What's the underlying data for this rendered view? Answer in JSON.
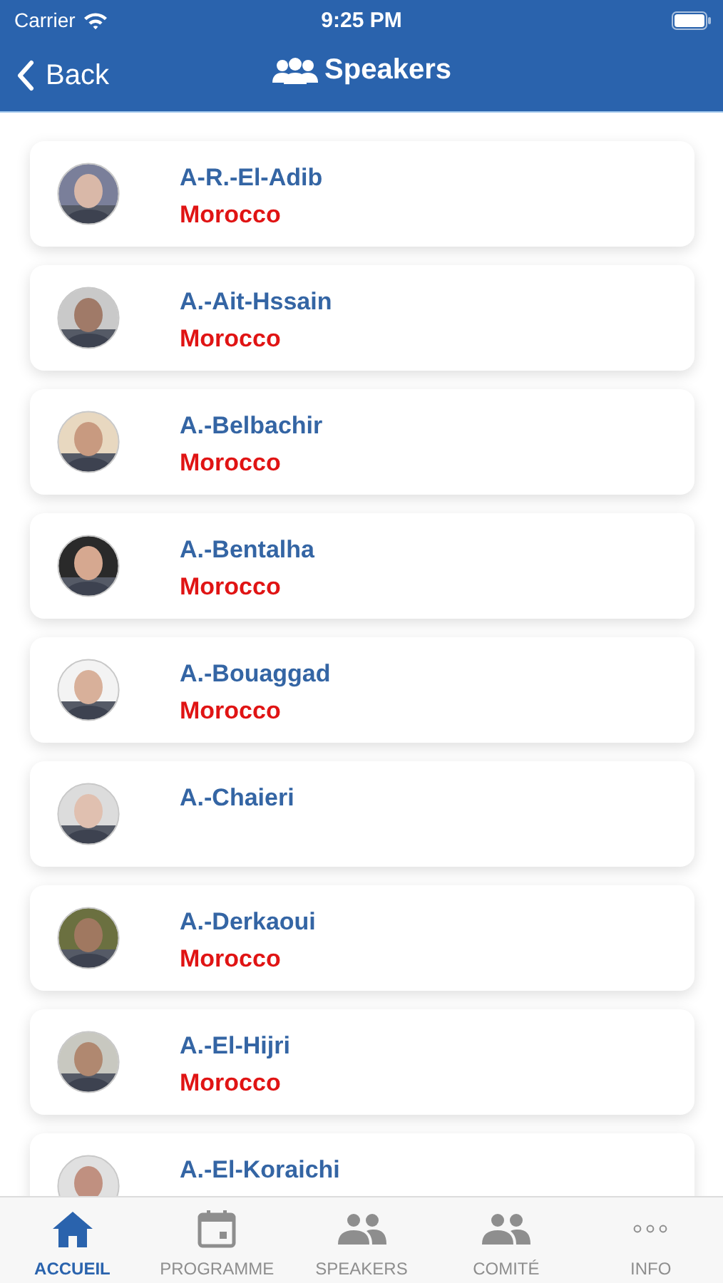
{
  "status_bar": {
    "carrier": "Carrier",
    "time": "9:25 PM"
  },
  "nav_bar": {
    "back": "Back",
    "title": "Speakers"
  },
  "speakers": [
    {
      "name": "A-R.-El-Adib",
      "country": "Morocco"
    },
    {
      "name": "A.-Ait-Hssain",
      "country": "Morocco"
    },
    {
      "name": "A.-Belbachir",
      "country": "Morocco"
    },
    {
      "name": "A.-Bentalha",
      "country": "Morocco"
    },
    {
      "name": "A.-Bouaggad",
      "country": "Morocco"
    },
    {
      "name": "A.-Chaieri"
    },
    {
      "name": "A.-Derkaoui",
      "country": "Morocco"
    },
    {
      "name": "A.-El-Hijri",
      "country": "Morocco"
    },
    {
      "name": "A.-El-Koraichi"
    }
  ],
  "tab_bar": [
    {
      "label": "ACCUEIL",
      "kind": "home",
      "selected": true
    },
    {
      "label": "PROGRAMME",
      "kind": "calendar",
      "selected": false
    },
    {
      "label": "SPEAKERS",
      "kind": "people",
      "selected": false
    },
    {
      "label": "COMITÉ",
      "kind": "people",
      "selected": false
    },
    {
      "label": "INFO",
      "kind": "more",
      "selected": false
    }
  ]
}
